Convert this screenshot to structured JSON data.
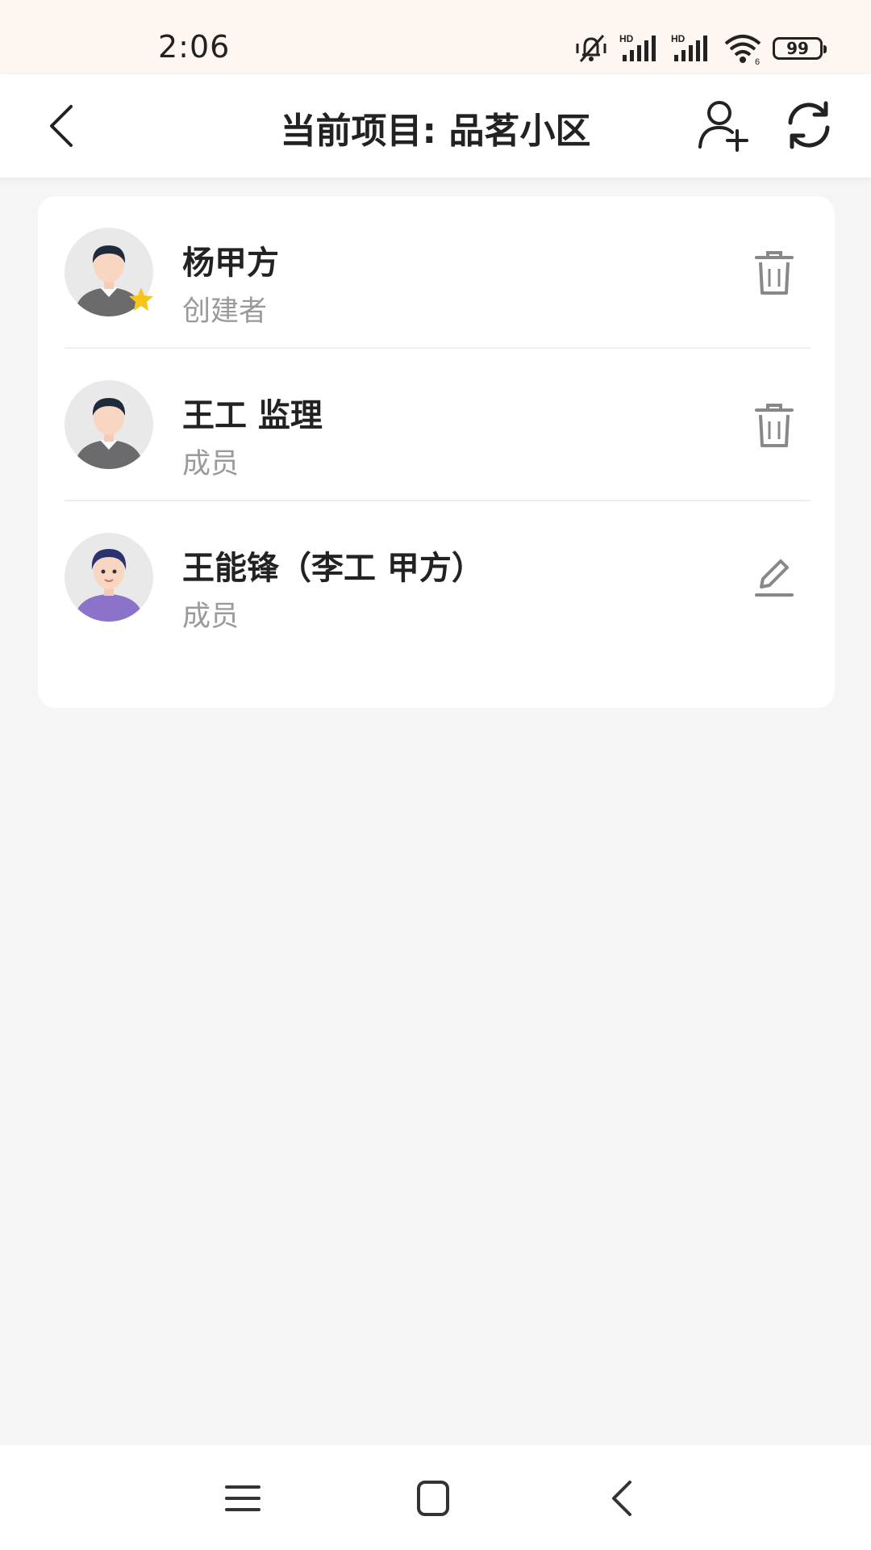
{
  "status_bar": {
    "time": "2:06",
    "battery": "99",
    "icons": [
      "mute-vibrate-icon",
      "signal-hd-icon",
      "signal-hd-icon",
      "wifi-icon",
      "battery-icon"
    ]
  },
  "header": {
    "title": "当前项目: 品茗小区",
    "back_icon": "chevron-left-icon",
    "add_member_icon": "add-user-icon",
    "refresh_icon": "refresh-icon"
  },
  "members": [
    {
      "name": "杨甲方",
      "role": "创建者",
      "action_icon": "trash-icon",
      "is_creator": true
    },
    {
      "name": "王工 监理",
      "role": "成员",
      "action_icon": "trash-icon",
      "is_creator": false
    },
    {
      "name": "王能锋（李工 甲方）",
      "role": "成员",
      "action_icon": "edit-icon",
      "is_creator": false
    }
  ],
  "nav_bar": {
    "icons": [
      "menu-icon",
      "home-icon",
      "back-icon"
    ]
  },
  "colors": {
    "status_bar_bg": "#fdf6f1",
    "page_bg": "#f5f5f5",
    "card_bg": "#ffffff",
    "secondary_text": "#9a9a9a",
    "creator_star": "#f5c518"
  }
}
